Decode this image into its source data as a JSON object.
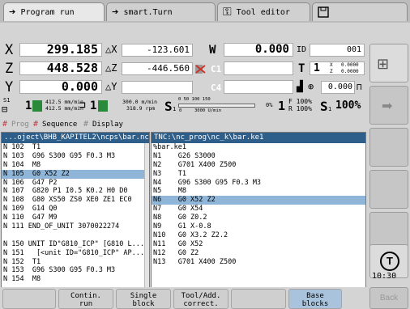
{
  "tabs": [
    {
      "label": "Program run",
      "icon": "arrow-right-icon"
    },
    {
      "label": "smart.Turn",
      "icon": "arrow-right-icon"
    },
    {
      "label": "Tool editor",
      "icon": "tool-icon"
    },
    {
      "label": "",
      "icon": "save-icon"
    }
  ],
  "positions": {
    "x": {
      "axis": "X",
      "value": "299.185",
      "delta_label": "△X",
      "delta_value": "-123.601",
      "aux_axis": "W",
      "aux_value": "0.000",
      "right_label": "ID",
      "right_value": "001"
    },
    "z": {
      "axis": "Z",
      "value": "448.528",
      "delta_label": "△Z",
      "delta_value": "-446.560",
      "aux_axis": "C1",
      "right_label": "T",
      "right_value": "1",
      "tx_label": "X",
      "tx_value": "0.0000",
      "tz_label": "Z",
      "tz_value": "0.0000"
    },
    "y": {
      "axis": "Y",
      "value": "0.000",
      "delta_label": "△Y",
      "aux_axis": "C4",
      "right_value": "0.000"
    }
  },
  "status": {
    "s1_label": "S1",
    "spindle_num": "1",
    "feed_top": "412.5 mm/min",
    "feed_bottom": "412.5 mm/min",
    "tool_num": "1",
    "speed_top": "300.0 m/min",
    "speed_bottom": "318.9 rpm",
    "s_label": "S",
    "s_sub": "1",
    "scale_ticks": "0   50   100   150",
    "scale_zero": "0",
    "scale_rpm": "3000 U/min",
    "pct0": "0%",
    "override_num": "1",
    "f_override": "F 100%",
    "r_override": "R 100%",
    "s_override_label": "S",
    "s_override_sub": "1",
    "s_override": "100%"
  },
  "modes": {
    "prog": "Prog",
    "sequence": "Sequence",
    "display": "Display"
  },
  "left_pane": {
    "header": "...oject\\BHB_KAPITEL2\\ncps\\bar.nc",
    "lines": [
      "N 102  T1",
      "N 103  G96 S300 G95 F0.3 M3",
      "N 104  M8",
      "N 105  G0 X52 Z2",
      "N 106  G47 P2",
      "N 107  G820 P1 I0.5 K0.2 H0 D0",
      "N 108  G80 XS50 ZS0 XE0 ZE1 EC0",
      "N 109  G14 Q0",
      "N 110  G47 M9",
      "N 111 END_OF_UNIT 3070022274",
      "",
      "N 150 UNIT ID\"G810_ICP\" [G810 L...",
      "N 151   [<unit ID=\"G810_ICP\" AP...",
      "N 152  T1",
      "N 153  G96 S300 G95 F0.3 M3",
      "N 154  M8"
    ],
    "selected_index": 3
  },
  "right_pane": {
    "header": "TNC:\\nc_prog\\nc_k\\bar.ke1",
    "lines": [
      "%bar.ke1",
      "N1    G26 S3000",
      "N2    G701 X400 Z500",
      "N3    T1",
      "N4    G96 S300 G95 F0.3 M3",
      "N5    M8",
      "N6    G0 X52 Z2",
      "N7    G0 X54",
      "N8    G0 Z0.2",
      "N9    G1 X-0.8",
      "N10   G0 X3.2 Z2.2",
      "N11   G0 X52",
      "N12   G0 Z2",
      "N13   G701 X400 Z500"
    ],
    "selected_index": 6
  },
  "bottom_keys": [
    {
      "line1": "Contin.",
      "line2": "run"
    },
    {
      "line1": "Single",
      "line2": "block"
    },
    {
      "line1": "Tool/Add.",
      "line2": "correct."
    },
    {
      "line1": "",
      "line2": ""
    },
    {
      "line1": "Base",
      "line2": "blocks"
    },
    {
      "line1": "",
      "line2": ""
    }
  ],
  "side": {
    "time": "10:30",
    "back": "Back"
  },
  "colors": {
    "header_blue": "#2e5f8a",
    "selection": "#8fb6d9",
    "spindle_green": "#2a8a3a"
  }
}
